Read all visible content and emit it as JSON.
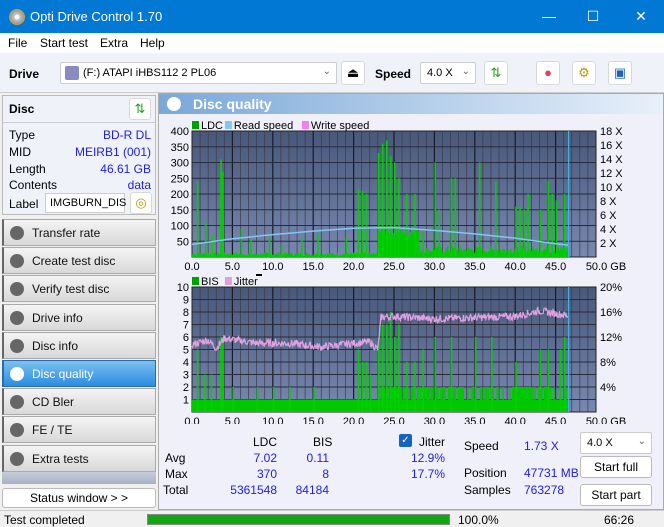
{
  "window": {
    "title": "Opti Drive Control 1.70",
    "minimize": "—",
    "maximize": "☐",
    "close": "✕"
  },
  "menu": [
    "File",
    "Start test",
    "Extra",
    "Help"
  ],
  "toolbar": {
    "drive_label": "Drive",
    "drive_value": "(F:)  ATAPI iHBS112  2 PL06",
    "speed_label": "Speed",
    "speed_value": "4.0 X"
  },
  "disc": {
    "header": "Disc",
    "rows": [
      {
        "key": "Type",
        "value": "BD-R DL"
      },
      {
        "key": "MID",
        "value": "MEIRB1 (001)"
      },
      {
        "key": "Length",
        "value": "46.61 GB"
      },
      {
        "key": "Contents",
        "value": "data"
      }
    ],
    "label_key": "Label",
    "label_value": "IMGBURN_DIS"
  },
  "nav": [
    {
      "label": "Transfer rate",
      "active": false
    },
    {
      "label": "Create test disc",
      "active": false
    },
    {
      "label": "Verify test disc",
      "active": false
    },
    {
      "label": "Drive info",
      "active": false
    },
    {
      "label": "Disc info",
      "active": false
    },
    {
      "label": "Disc quality",
      "active": true
    },
    {
      "label": "CD Bler",
      "active": false
    },
    {
      "label": "FE / TE",
      "active": false
    },
    {
      "label": "Extra tests",
      "active": false
    }
  ],
  "status_window_btn": "Status window > >",
  "panel_title": "Disc quality",
  "chart_data": [
    {
      "type": "bar",
      "title": "LDC",
      "legend": [
        "LDC",
        "Read speed",
        "Write speed"
      ],
      "legend_colors": [
        "#00a000",
        "#80c8f0",
        "#f080f0"
      ],
      "x_ticks": [
        "0.0",
        "5.0",
        "10.0",
        "15.0",
        "20.0",
        "25.0",
        "30.0",
        "35.0",
        "40.0",
        "45.0",
        "50.0 GB"
      ],
      "y_ticks": [
        "50",
        "100",
        "150",
        "200",
        "250",
        "300",
        "350",
        "400"
      ],
      "y2_ticks": [
        "2 X",
        "4 X",
        "6 X",
        "8 X",
        "10 X",
        "12 X",
        "14 X",
        "16 X",
        "18 X"
      ],
      "xlim": [
        0,
        50
      ],
      "ylim": [
        0,
        400
      ],
      "y2lim": [
        0,
        18
      ],
      "ldc_peaks": [
        [
          0.6,
          240
        ],
        [
          1.6,
          110
        ],
        [
          2.4,
          70
        ],
        [
          3.5,
          310
        ],
        [
          3.7,
          270
        ],
        [
          6.0,
          90
        ],
        [
          7.2,
          55
        ],
        [
          9.5,
          60
        ],
        [
          11.0,
          40
        ],
        [
          13.5,
          60
        ],
        [
          15.5,
          75
        ],
        [
          19.0,
          60
        ],
        [
          20.5,
          215
        ],
        [
          21.0,
          210
        ],
        [
          21.5,
          200
        ],
        [
          23.0,
          330
        ],
        [
          23.5,
          360
        ],
        [
          24.0,
          370
        ],
        [
          24.5,
          320
        ],
        [
          25.0,
          300
        ],
        [
          25.5,
          250
        ],
        [
          26.5,
          200
        ],
        [
          27.5,
          200
        ],
        [
          28.5,
          80
        ],
        [
          30.0,
          300
        ],
        [
          30.5,
          150
        ],
        [
          32.0,
          250
        ],
        [
          32.5,
          250
        ],
        [
          35.5,
          300
        ],
        [
          37.5,
          240
        ],
        [
          40.0,
          160
        ],
        [
          40.5,
          160
        ],
        [
          41.0,
          150
        ],
        [
          41.5,
          200
        ],
        [
          43.0,
          150
        ],
        [
          44.0,
          240
        ],
        [
          44.5,
          200
        ],
        [
          45.0,
          180
        ],
        [
          46.0,
          200
        ]
      ],
      "read_speed": [
        [
          0,
          1.8
        ],
        [
          5,
          2.6
        ],
        [
          10,
          3.2
        ],
        [
          15,
          3.7
        ],
        [
          20,
          4.1
        ],
        [
          25,
          4.2
        ],
        [
          30,
          3.8
        ],
        [
          35,
          3.3
        ],
        [
          40,
          2.7
        ],
        [
          45,
          1.9
        ],
        [
          46.6,
          1.7
        ]
      ],
      "end_marker_gb": 46.61
    },
    {
      "type": "bar",
      "title": "BIS",
      "legend": [
        "BIS",
        "Jitter"
      ],
      "legend_colors": [
        "#00a000",
        "#e0a0e0"
      ],
      "x_ticks": [
        "0.0",
        "5.0",
        "10.0",
        "15.0",
        "20.0",
        "25.0",
        "30.0",
        "35.0",
        "40.0",
        "45.0",
        "50.0 GB"
      ],
      "y_ticks": [
        "1",
        "2",
        "3",
        "4",
        "5",
        "6",
        "7",
        "8",
        "9",
        "10"
      ],
      "y2_ticks": [
        "4%",
        "8%",
        "12%",
        "16%",
        "20%"
      ],
      "xlim": [
        0,
        50
      ],
      "ylim": [
        0,
        10
      ],
      "y2lim": [
        0,
        20
      ],
      "bis_peaks": [
        [
          0.6,
          5
        ],
        [
          1.5,
          3
        ],
        [
          2.3,
          3
        ],
        [
          3.5,
          6
        ],
        [
          3.7,
          6
        ],
        [
          5.0,
          2
        ],
        [
          8.0,
          2
        ],
        [
          10.0,
          2
        ],
        [
          12.0,
          2
        ],
        [
          15.0,
          2
        ],
        [
          20.5,
          5
        ],
        [
          21.0,
          4
        ],
        [
          21.5,
          4
        ],
        [
          22.0,
          3
        ],
        [
          23.0,
          6
        ],
        [
          23.5,
          7
        ],
        [
          24.0,
          7
        ],
        [
          24.5,
          8
        ],
        [
          25.0,
          6
        ],
        [
          25.5,
          7
        ],
        [
          26.5,
          4
        ],
        [
          27.5,
          4
        ],
        [
          28.5,
          5
        ],
        [
          30.0,
          6
        ],
        [
          32.0,
          6
        ],
        [
          35.0,
          6
        ],
        [
          37.0,
          6
        ],
        [
          40.0,
          4
        ],
        [
          43.0,
          5
        ],
        [
          44.0,
          5
        ],
        [
          45.5,
          5
        ],
        [
          46.0,
          6
        ]
      ],
      "jitter": [
        [
          0,
          10.8
        ],
        [
          2,
          11.5
        ],
        [
          3,
          10.2
        ],
        [
          4,
          11.8
        ],
        [
          8,
          11.0
        ],
        [
          12,
          11.0
        ],
        [
          16,
          10.4
        ],
        [
          20,
          11.0
        ],
        [
          22,
          11.2
        ],
        [
          23,
          10.0
        ],
        [
          23.4,
          15.2
        ],
        [
          25,
          15.3
        ],
        [
          30,
          14.9
        ],
        [
          35,
          15.1
        ],
        [
          40,
          15.3
        ],
        [
          43,
          16.2
        ],
        [
          46.6,
          15.4
        ]
      ],
      "end_marker_gb": 46.61
    }
  ],
  "stats": {
    "col_ldc": "LDC",
    "col_bis": "BIS",
    "jitter_label": "Jitter",
    "jitter_checked": true,
    "rows": [
      {
        "label": "Avg",
        "ldc": "7.02",
        "bis": "0.11",
        "jitter": "12.9%"
      },
      {
        "label": "Max",
        "ldc": "370",
        "bis": "8",
        "jitter": "17.7%"
      },
      {
        "label": "Total",
        "ldc": "5361548",
        "bis": "84184",
        "jitter": ""
      }
    ],
    "speed_label": "Speed",
    "speed_value": "1.73 X",
    "position_label": "Position",
    "position_value": "47731 MB",
    "samples_label": "Samples",
    "samples_value": "763278",
    "speed_select": "4.0 X",
    "start_full": "Start full",
    "start_part": "Start part"
  },
  "status": {
    "text": "Test completed",
    "progress": 1.0,
    "percent": "100.0%",
    "time": "66:26"
  }
}
